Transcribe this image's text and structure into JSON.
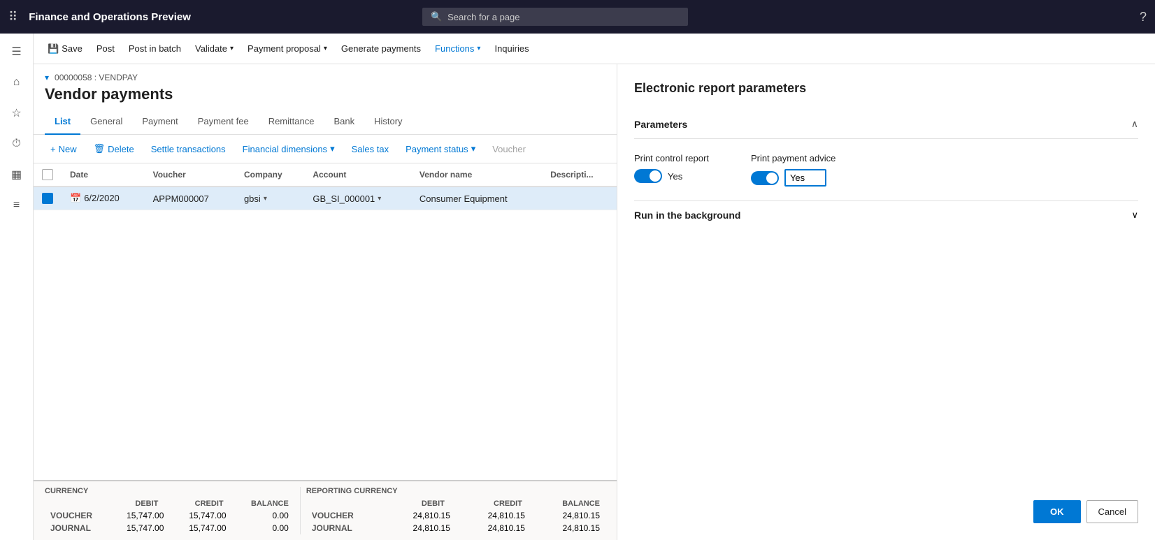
{
  "app": {
    "title": "Finance and Operations Preview",
    "search_placeholder": "Search for a page",
    "help_icon": "?"
  },
  "sidebar": {
    "icons": [
      "grid",
      "home",
      "star",
      "clock",
      "table",
      "list"
    ]
  },
  "command_bar": {
    "save_label": "Save",
    "post_label": "Post",
    "post_in_batch_label": "Post in batch",
    "validate_label": "Validate",
    "payment_proposal_label": "Payment proposal",
    "generate_payments_label": "Generate payments",
    "functions_label": "Functions",
    "inquiries_label": "Inquiries"
  },
  "page": {
    "meta": "00000058 : VENDPAY",
    "title": "Vendor payments",
    "tabs": [
      "List",
      "General",
      "Payment",
      "Payment fee",
      "Remittance",
      "Bank",
      "History"
    ],
    "active_tab": "List"
  },
  "toolbar": {
    "new_label": "New",
    "delete_label": "Delete",
    "settle_transactions_label": "Settle transactions",
    "financial_dimensions_label": "Financial dimensions",
    "sales_tax_label": "Sales tax",
    "payment_status_label": "Payment status",
    "voucher_label": "Voucher"
  },
  "table": {
    "columns": [
      "",
      "Date",
      "Voucher",
      "Company",
      "Account",
      "Vendor name",
      "Description"
    ],
    "rows": [
      {
        "selected": true,
        "date": "6/2/2020",
        "voucher": "APPM000007",
        "company": "gbsi",
        "account": "GB_SI_000001",
        "vendor_name": "Consumer Equipment",
        "description": ""
      }
    ]
  },
  "footer": {
    "currency_label": "CURRENCY",
    "reporting_currency_label": "REPORTING CURRENCY",
    "debit_label": "DEBIT",
    "credit_label": "CREDIT",
    "balance_label": "BALANCE",
    "rows": [
      {
        "label": "VOUCHER",
        "debit": "15,747.00",
        "credit": "15,747.00",
        "balance": "0.00",
        "rep_debit": "24,810.15",
        "rep_credit": "24,810.15",
        "rep_balance": "24,810.15"
      },
      {
        "label": "JOURNAL",
        "debit": "15,747.00",
        "credit": "15,747.00",
        "balance": "0.00",
        "rep_debit": "24,810.15",
        "rep_credit": "24,810.15",
        "rep_balance": "24,810.15"
      }
    ]
  },
  "right_panel": {
    "title": "Electronic report parameters",
    "parameters_section": "Parameters",
    "print_control_report_label": "Print control report",
    "print_control_report_value": "Yes",
    "print_payment_advice_label": "Print payment advice",
    "print_payment_advice_value": "Yes",
    "run_in_background_label": "Run in the background",
    "ok_label": "OK",
    "cancel_label": "Cancel"
  }
}
